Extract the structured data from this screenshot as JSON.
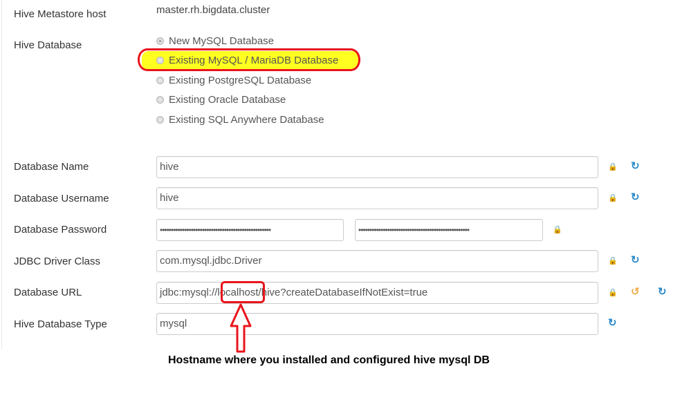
{
  "metastore": {
    "label": "Hive Metastore host",
    "value": "master.rh.bigdata.cluster"
  },
  "hive_database": {
    "label": "Hive Database",
    "options": [
      "New MySQL Database",
      "Existing MySQL / MariaDB Database",
      "Existing PostgreSQL Database",
      "Existing Oracle Database",
      "Existing SQL Anywhere Database"
    ],
    "selected": "New MySQL Database"
  },
  "fields": {
    "db_name": {
      "label": "Database Name",
      "value": "hive"
    },
    "db_user": {
      "label": "Database Username",
      "value": "hive"
    },
    "db_password": {
      "label": "Database Password",
      "value": "••••••••••••••••••••••••••••••••••••••••••••••••••",
      "confirm": "••••••••••••••••••••••••••••••••••••••••••••••••••"
    },
    "jdbc_driver": {
      "label": "JDBC Driver Class",
      "value": "com.mysql.jdbc.Driver"
    },
    "db_url": {
      "label": "Database URL",
      "value": "jdbc:mysql://localhost/hive?createDatabaseIfNotExist=true"
    },
    "db_type": {
      "label": "Hive Database Type",
      "value": "mysql"
    }
  },
  "annotation": {
    "text": "Hostname where you installed and configured hive mysql DB",
    "color": "#e8141c",
    "highlight": "#ffff20"
  }
}
